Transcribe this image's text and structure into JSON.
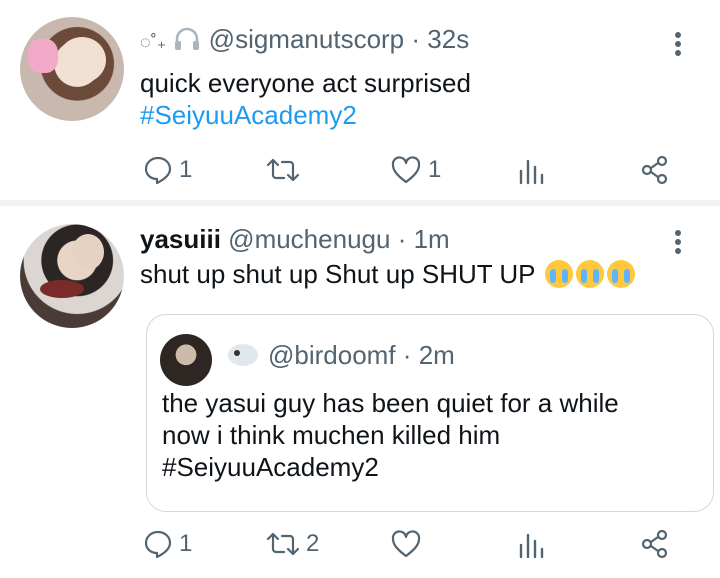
{
  "tweets": [
    {
      "display_symbols": "◌˚₊",
      "handle": "@sigmanutscorp",
      "sep": "·",
      "time": "32s",
      "text": "quick everyone act surprised",
      "hashtag": "#SeiyuuAcademy2",
      "actions": {
        "replies": "1",
        "retweets": "",
        "likes": "1"
      }
    },
    {
      "name": "yasuiii",
      "handle": "@muchenugu",
      "sep": "·",
      "time": "1m",
      "text": "shut up shut up Shut up SHUT UP",
      "emoji": [
        "loudly-crying-face",
        "loudly-crying-face",
        "loudly-crying-face"
      ],
      "actions": {
        "replies": "1",
        "retweets": "2",
        "likes": ""
      },
      "quote": {
        "handle": "@birdoomf",
        "sep": "·",
        "time": "2m",
        "line1": "the yasui guy has been quiet for a while",
        "line2": "now i think muchen killed him",
        "hashtag": "#SeiyuuAcademy2"
      }
    }
  ],
  "colors": {
    "accent": "#1d9bf0",
    "muted": "#536471",
    "text": "#0f1419",
    "border": "#cfd9de",
    "divider": "#eff3f4"
  },
  "icons": [
    "reply-icon",
    "retweet-icon",
    "like-icon",
    "analytics-icon",
    "share-icon",
    "more-icon"
  ]
}
